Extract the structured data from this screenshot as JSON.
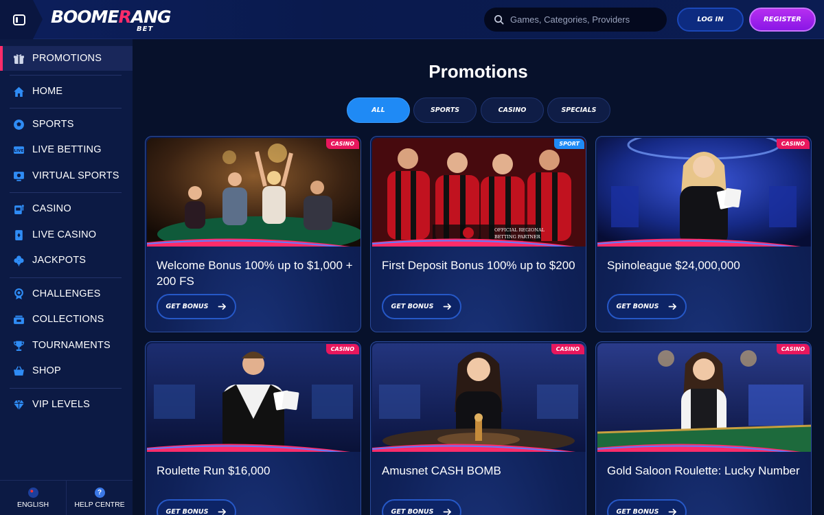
{
  "header": {
    "logo_text": "BOOMERANG",
    "logo_sub": "BET",
    "search_placeholder": "Games, Categories, Providers",
    "login_label": "LOG IN",
    "register_label": "REGISTER"
  },
  "sidebar": {
    "items": [
      {
        "label": "PROMOTIONS",
        "icon": "gift-icon"
      },
      {
        "label": "HOME",
        "icon": "home-icon"
      },
      {
        "label": "SPORTS",
        "icon": "soccer-ball-icon"
      },
      {
        "label": "LIVE BETTING",
        "icon": "live-tv-icon"
      },
      {
        "label": "VIRTUAL SPORTS",
        "icon": "monitor-icon"
      },
      {
        "label": "CASINO",
        "icon": "slot-machine-icon"
      },
      {
        "label": "LIVE CASINO",
        "icon": "playing-card-icon"
      },
      {
        "label": "JACKPOTS",
        "icon": "clover-icon"
      },
      {
        "label": "CHALLENGES",
        "icon": "medal-icon"
      },
      {
        "label": "COLLECTIONS",
        "icon": "collection-icon"
      },
      {
        "label": "TOURNAMENTS",
        "icon": "trophy-icon"
      },
      {
        "label": "SHOP",
        "icon": "basket-icon"
      },
      {
        "label": "VIP LEVELS",
        "icon": "diamond-icon"
      }
    ],
    "language_label": "ENGLISH",
    "help_label": "HELP CENTRE"
  },
  "main": {
    "title": "Promotions",
    "tabs": [
      "ALL",
      "SPORTS",
      "CASINO",
      "SPECIALS"
    ],
    "active_tab": "ALL",
    "button_label": "GET BONUS",
    "cards": [
      {
        "tag": "CASINO",
        "title": "Welcome Bonus 100% up to $1,000 + 200 FS"
      },
      {
        "tag": "SPORT",
        "title": "First Deposit Bonus 100% up to $200",
        "image_text_1": "OFFICIAL REGIONAL",
        "image_text_2": "BETTING PARTNER"
      },
      {
        "tag": "CASINO",
        "title": "Spinoleague $24,000,000"
      },
      {
        "tag": "CASINO",
        "title": "Roulette Run $16,000"
      },
      {
        "tag": "CASINO",
        "title": "Amusnet CASH BOMB"
      },
      {
        "tag": "CASINO",
        "title": "Gold Saloon Roulette: Lucky Number"
      }
    ]
  },
  "colors": {
    "accent_pink": "#ff2c6a",
    "accent_blue": "#1f8af5",
    "register_purple": "#a322ec",
    "background": "#07112b",
    "sidebar": "#0c1a44"
  }
}
